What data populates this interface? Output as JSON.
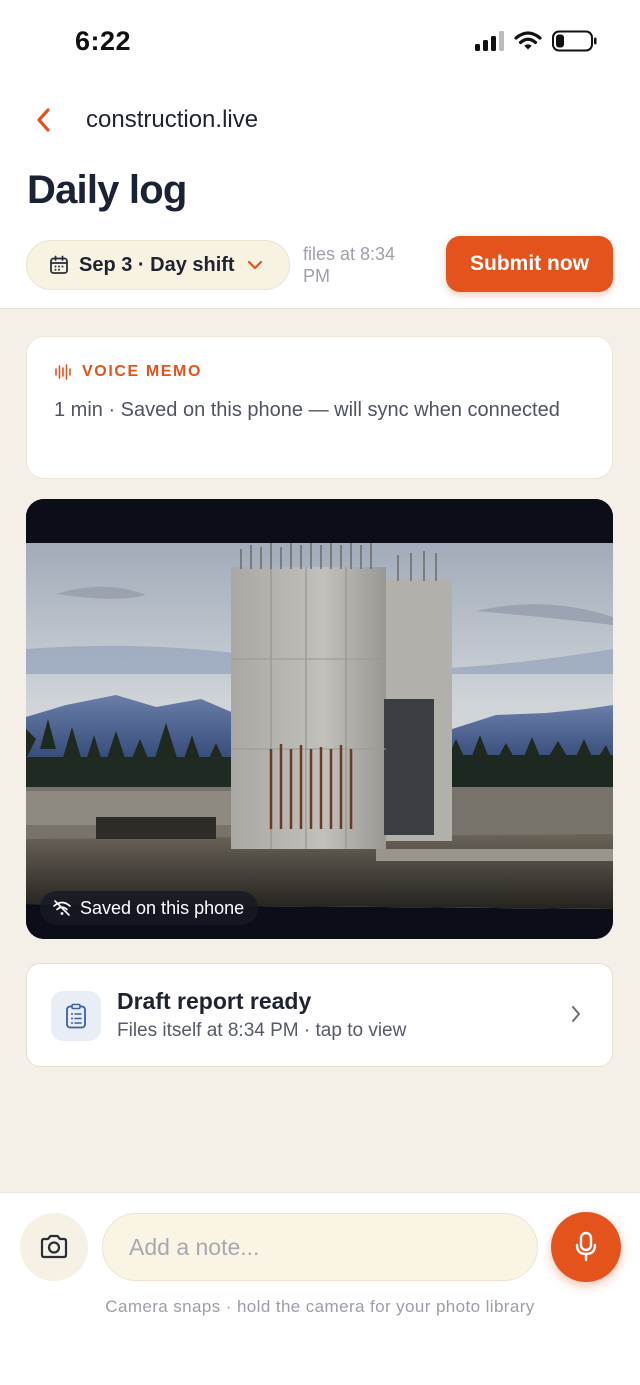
{
  "status_bar": {
    "time": "6:22",
    "signal_icon": "cellular-signal-icon",
    "wifi_icon": "wifi-icon",
    "battery_icon": "battery-icon"
  },
  "nav": {
    "back_icon": "chevron-left-icon",
    "title": "construction.live"
  },
  "page": {
    "title": "Daily log"
  },
  "shift": {
    "calendar_icon": "calendar-icon",
    "label": "Sep 3 · Day shift",
    "files_at": "files at 8:34 PM"
  },
  "submit": {
    "label": "Submit now"
  },
  "voice_memo": {
    "tag": "VOICE MEMO",
    "text": "1 min · Saved on this phone — will sync when connected"
  },
  "photo": {
    "badge_icon": "wifi-off-icon",
    "badge": "Saved on this phone"
  },
  "draft": {
    "icon": "clipboard-icon",
    "title": "Draft report ready",
    "subtitle": "Files itself at 8:34 PM · tap to view"
  },
  "composer": {
    "placeholder": "Add a note...",
    "camera_icon": "camera-icon",
    "mic_icon": "microphone-icon",
    "hint": "Camera snaps · hold the camera for your photo library"
  },
  "colors": {
    "accent": "#e5531c",
    "background": "#f4f0e8",
    "text": "#1f2330"
  }
}
